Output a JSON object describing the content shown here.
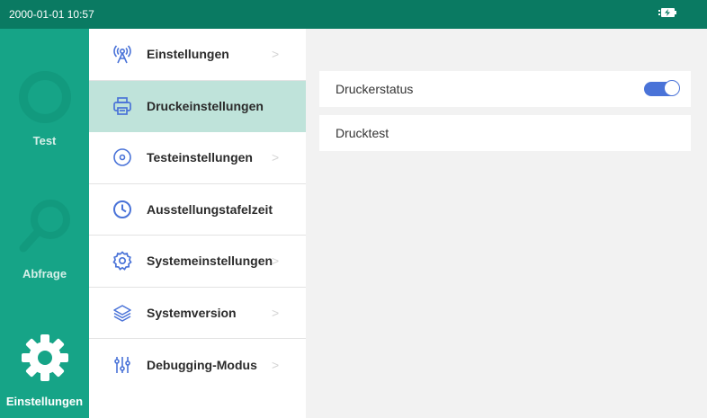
{
  "status_bar": {
    "datetime": "2000-01-01 10:57",
    "battery_icon": "battery-charging-icon"
  },
  "nav_rail": {
    "items": [
      {
        "label": "Test",
        "icon": "test-ring-icon"
      },
      {
        "label": "Abfrage",
        "icon": "search-icon"
      },
      {
        "label": "Einstellungen",
        "icon": "gear-icon"
      }
    ],
    "active_index": 2
  },
  "settings_menu": {
    "items": [
      {
        "label": "Einstellungen",
        "icon": "antenna-icon"
      },
      {
        "label": "Druckeinstellungen",
        "icon": "printer-icon"
      },
      {
        "label": "Testeinstellungen",
        "icon": "target-icon"
      },
      {
        "label": "Ausstellungstafelzeit",
        "icon": "clock-icon"
      },
      {
        "label": "Systemeinstellungen",
        "icon": "gear-outline-icon"
      },
      {
        "label": "Systemversion",
        "icon": "layers-icon"
      },
      {
        "label": "Debugging-Modus",
        "icon": "sliders-icon"
      }
    ],
    "active_index": 1
  },
  "content": {
    "printer_status_label": "Druckerstatus",
    "printer_status_on": true,
    "print_test_label": "Drucktest"
  },
  "colors": {
    "status_bar": "#0a7a62",
    "rail": "#16a487",
    "active_menu": "#bfe3da",
    "accent": "#1aa585",
    "toggle": "#4a73d8"
  }
}
